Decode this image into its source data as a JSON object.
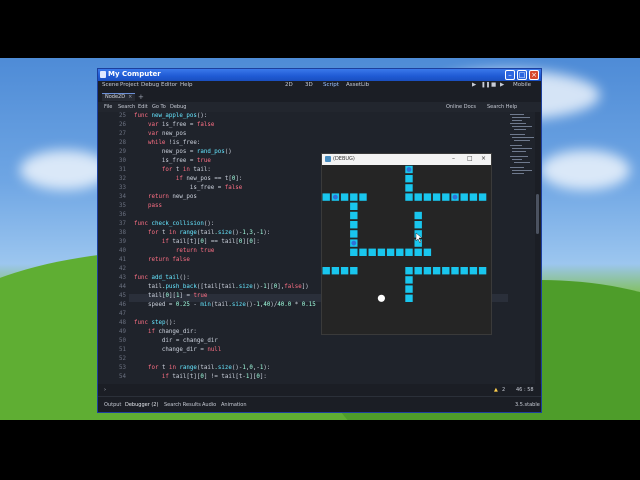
{
  "window": {
    "title": "My Computer",
    "controls": [
      "minimize",
      "maximize",
      "close"
    ]
  },
  "menubar": {
    "items": [
      "Scene",
      "Project",
      "Debug",
      "Editor",
      "Help"
    ],
    "modes": [
      "2D",
      "3D",
      "Script",
      "AssetLib"
    ],
    "active_mode": "Script",
    "renderer": "Mobile"
  },
  "tabs": [
    {
      "label": "Node2D",
      "closable": true
    }
  ],
  "script_menu": {
    "items": [
      "File",
      "Search",
      "Edit",
      "Go To",
      "Debug"
    ],
    "right_items": [
      "Online Docs",
      "Search Help"
    ]
  },
  "editor": {
    "highlight_line": "46",
    "lines": [
      {
        "n": "25",
        "t": "func new_apple_pos():"
      },
      {
        "n": "26",
        "t": "    var is_free = false"
      },
      {
        "n": "27",
        "t": "    var new_pos"
      },
      {
        "n": "28",
        "t": "    while !is_free:"
      },
      {
        "n": "29",
        "t": "        new_pos = rand_pos()"
      },
      {
        "n": "30",
        "t": "        is_free = true"
      },
      {
        "n": "31",
        "t": "        for t in tail:"
      },
      {
        "n": "32",
        "t": "            if new_pos == t[0]:"
      },
      {
        "n": "33",
        "t": "                is_free = false"
      },
      {
        "n": "34",
        "t": "    return new_pos"
      },
      {
        "n": "35",
        "t": "    pass"
      },
      {
        "n": "36",
        "t": ""
      },
      {
        "n": "37",
        "t": "func check_collision():"
      },
      {
        "n": "38",
        "t": "    for t in range(tail.size()-1,3,-1):"
      },
      {
        "n": "39",
        "t": "        if tail[t][0] == tail[0][0]:"
      },
      {
        "n": "40",
        "t": "            return true"
      },
      {
        "n": "41",
        "t": "    return false"
      },
      {
        "n": "42",
        "t": ""
      },
      {
        "n": "43",
        "t": "func add_tail():"
      },
      {
        "n": "44",
        "t": "    tail.push_back([tail[tail.size()-1][0],false])"
      },
      {
        "n": "45",
        "t": "    tail[0][1] = true"
      },
      {
        "n": "46",
        "t": "    speed = 0.25 - min(tail.size()-1,40)/40.0 * 0.15"
      },
      {
        "n": "47",
        "t": ""
      },
      {
        "n": "48",
        "t": "func step():"
      },
      {
        "n": "49",
        "t": "    if change_dir:"
      },
      {
        "n": "50",
        "t": "        dir = change_dir"
      },
      {
        "n": "51",
        "t": "        change_dir = null"
      },
      {
        "n": "52",
        "t": ""
      },
      {
        "n": "53",
        "t": "    for t in range(tail.size()-1,0,-1):"
      },
      {
        "n": "54",
        "t": "        if tail[t][0] != tail[t-1][0]:"
      }
    ]
  },
  "status": {
    "warnings": "2",
    "position": "46 : 58"
  },
  "bottom_panel": {
    "tabs": [
      "Output",
      "Debugger (2)",
      "Search Results",
      "Audio",
      "Animation"
    ],
    "version": "3.5.stable"
  },
  "game_window": {
    "title": "(DEBUG)",
    "controls": [
      "minimize",
      "maximize",
      "close"
    ]
  },
  "colors": {
    "snake": "#19c6ee",
    "snake_head": "#2f72d9",
    "apple": "#ffffff",
    "game_bg": "#252525",
    "editor_bg": "#1f232b"
  }
}
